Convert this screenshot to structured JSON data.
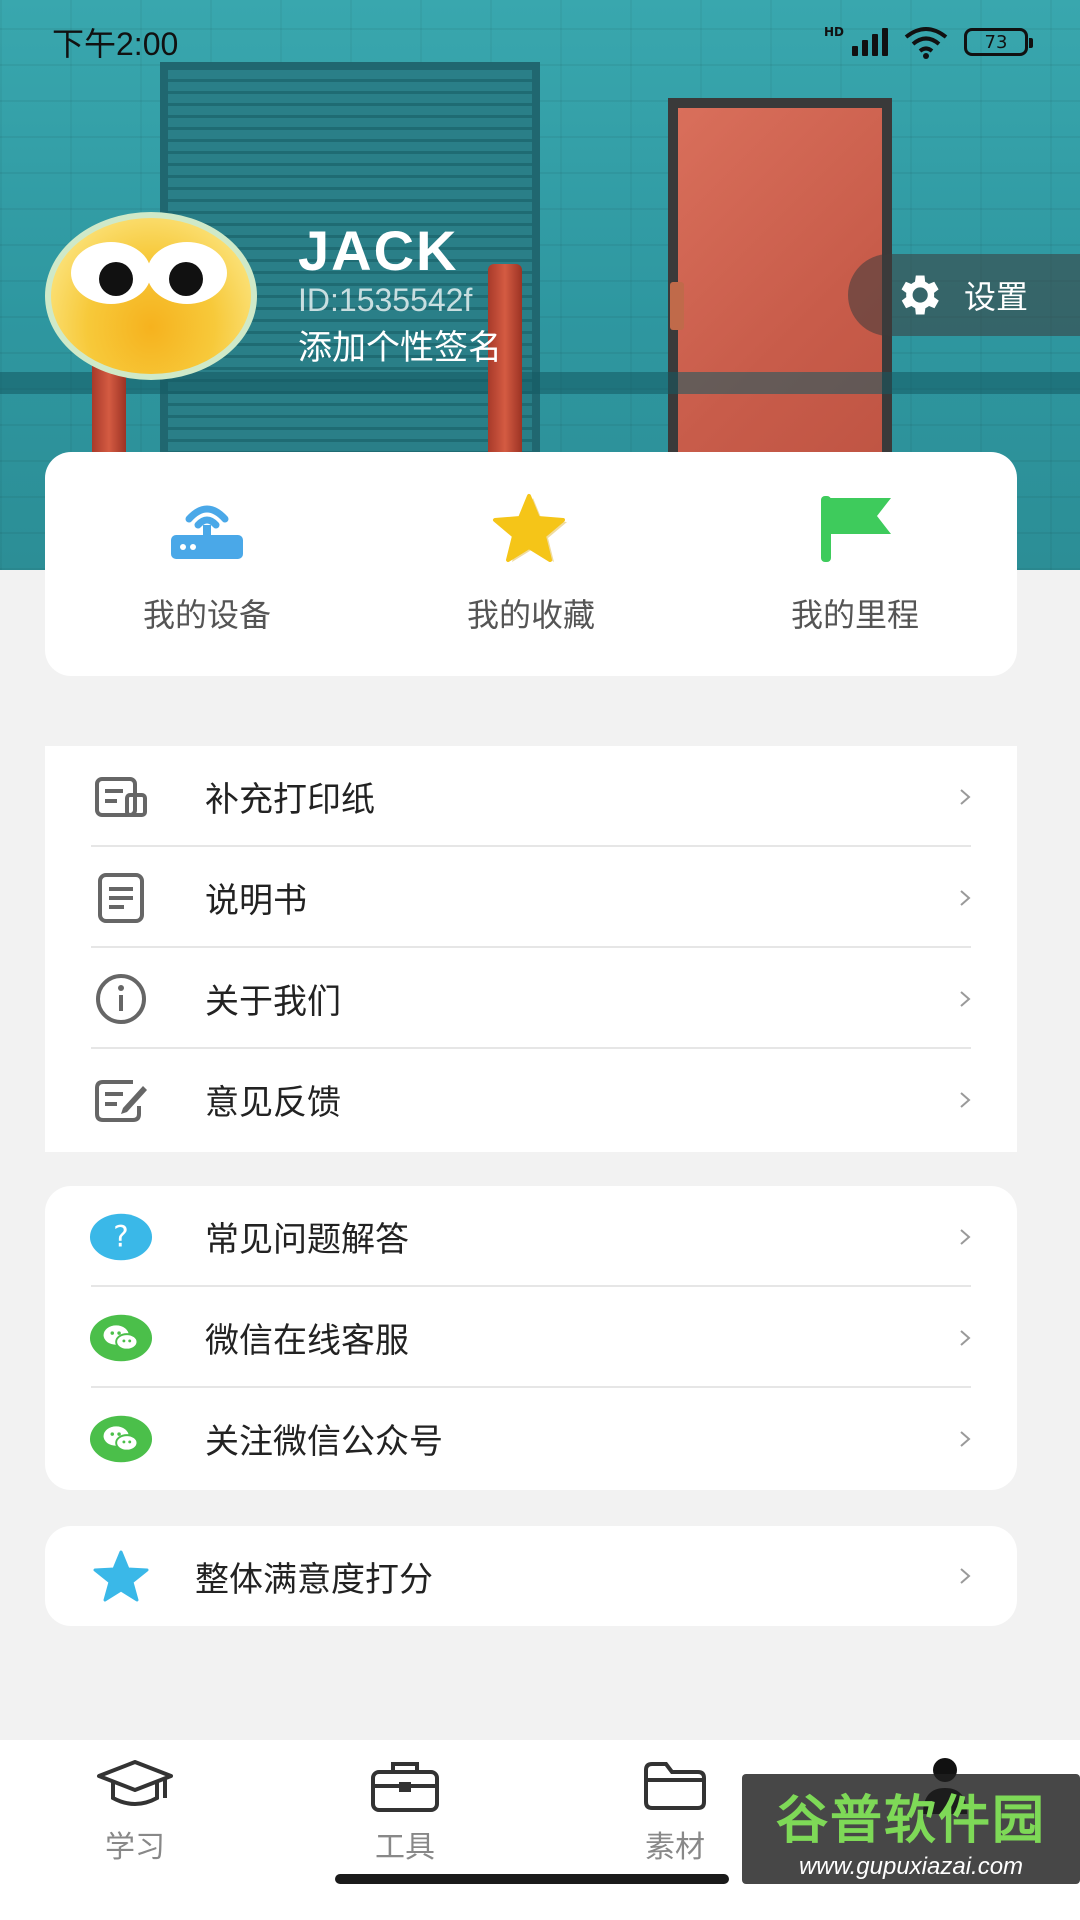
{
  "status_bar": {
    "time": "下午2:00",
    "network_badge": "HD",
    "battery": "73"
  },
  "profile": {
    "name": "JACK",
    "id": "ID:1535542f",
    "signature": "添加个性签名",
    "settings_label": "设置"
  },
  "quick_actions": [
    {
      "label": "我的设备",
      "icon": "router-icon",
      "color": "#4aa8e8"
    },
    {
      "label": "我的收藏",
      "icon": "star-icon",
      "color": "#f5c518"
    },
    {
      "label": "我的里程",
      "icon": "flag-icon",
      "color": "#3ecb5c"
    }
  ],
  "menu_section_1": [
    {
      "label": "补充打印纸",
      "icon": "printer-paper-icon"
    },
    {
      "label": "说明书",
      "icon": "manual-icon"
    },
    {
      "label": "关于我们",
      "icon": "info-icon"
    },
    {
      "label": "意见反馈",
      "icon": "feedback-icon"
    }
  ],
  "menu_section_2": [
    {
      "label": "常见问题解答",
      "icon": "question-icon",
      "color": "#3ab8e8"
    },
    {
      "label": "微信在线客服",
      "icon": "wechat-icon",
      "color": "#4bbf4a"
    },
    {
      "label": "关注微信公众号",
      "icon": "wechat-icon",
      "color": "#4bbf4a"
    }
  ],
  "menu_section_3": [
    {
      "label": "整体满意度打分",
      "icon": "star-icon",
      "color": "#3ab8e8"
    }
  ],
  "bottom_nav": [
    {
      "label": "学习",
      "icon": "graduation-cap-icon"
    },
    {
      "label": "工具",
      "icon": "toolbox-icon"
    },
    {
      "label": "素材",
      "icon": "folder-icon"
    },
    {
      "label": "",
      "icon": "person-icon"
    }
  ],
  "watermark": {
    "main": "谷普软件园",
    "sub": "www.gupuxiazai.com"
  }
}
